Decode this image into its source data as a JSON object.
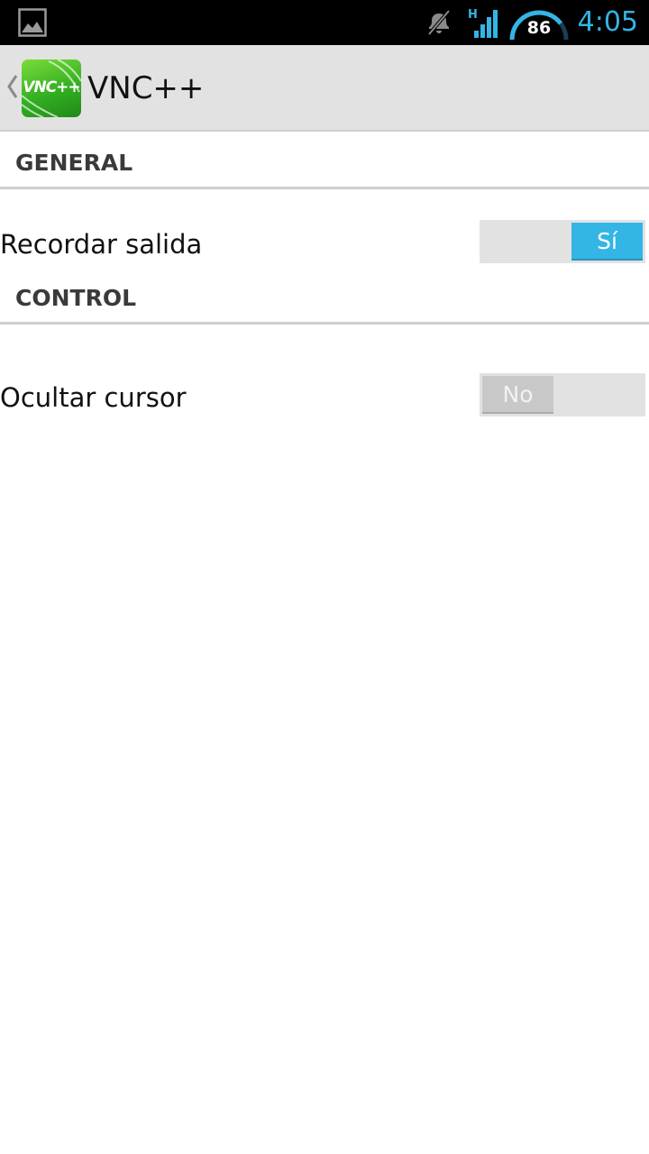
{
  "status_bar": {
    "battery_level": "86",
    "network_type": "H",
    "time": "4:05",
    "icons": [
      "image-notification-icon",
      "mute-icon",
      "signal-icon",
      "battery-icon"
    ]
  },
  "action_bar": {
    "app_icon_text": "VNC++",
    "title": "VNC++"
  },
  "sections": {
    "general": {
      "header": "GENERAL",
      "pref_title": "Recordar salida",
      "switch_label": "Sí",
      "switch_state": "on"
    },
    "control": {
      "header": "CONTROL",
      "pref_title": "Ocultar cursor",
      "switch_label": "No",
      "switch_state": "off"
    }
  },
  "colors": {
    "accent": "#33b5e5",
    "action_bar_bg": "#e2e2e2",
    "status_bar_bg": "#000000",
    "logo_green": "#33b022"
  }
}
